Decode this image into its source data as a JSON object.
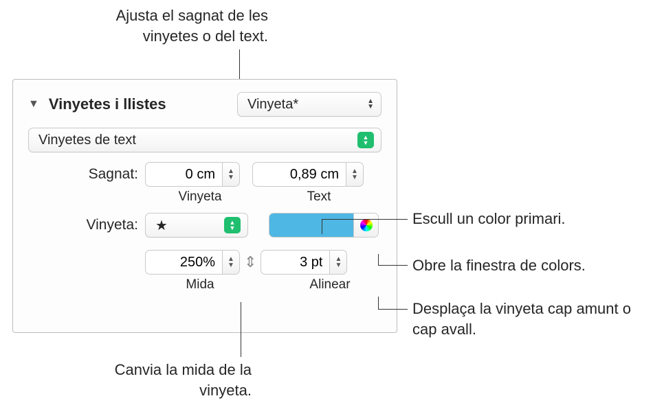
{
  "callouts": {
    "top": "Ajusta el sagnat de les vinyetes o del text.",
    "color_primary": "Escull un color primari.",
    "color_window": "Obre la finestra de colors.",
    "align": "Desplaça la vinyeta cap amunt o cap avall.",
    "size": "Canvia la mida de la vinyeta."
  },
  "panel": {
    "section_title": "Vinyetes i llistes",
    "style_dropdown": "Vinyeta*",
    "type_dropdown": "Vinyetes de text",
    "indent": {
      "label": "Sagnat:",
      "bullet_value": "0 cm",
      "bullet_caption": "Vinyeta",
      "text_value": "0,89 cm",
      "text_caption": "Text"
    },
    "bullet": {
      "label": "Vinyeta:",
      "glyph": "★",
      "color": "#4fb7e3"
    },
    "size": {
      "value": "250%",
      "caption": "Mida"
    },
    "align": {
      "value": "3 pt",
      "caption": "Alinear"
    }
  }
}
